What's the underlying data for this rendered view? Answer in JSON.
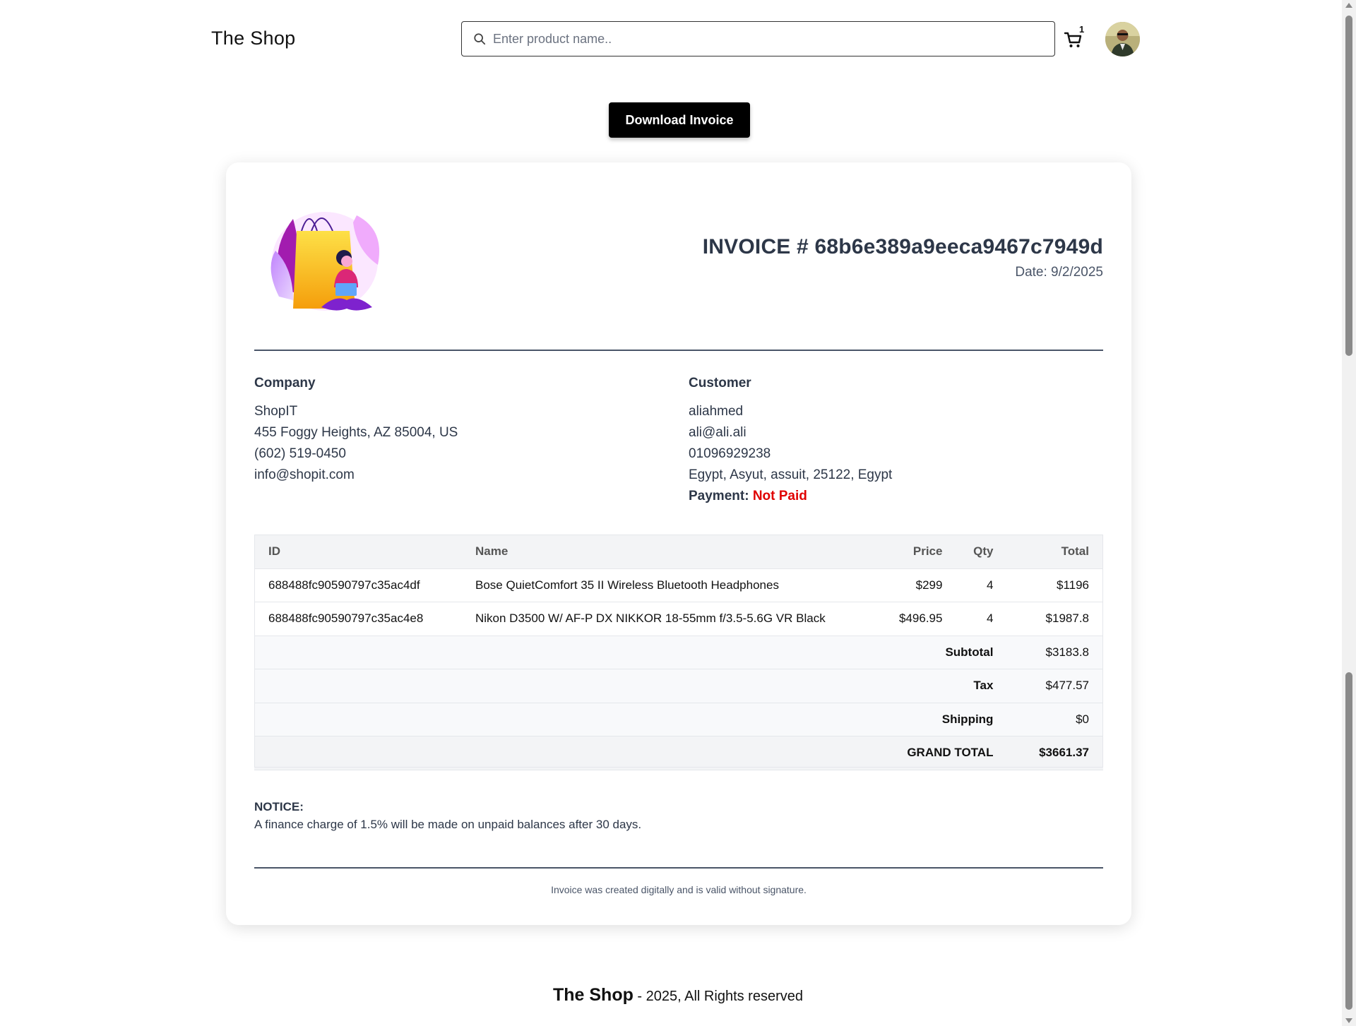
{
  "header": {
    "brand": "The Shop",
    "search_placeholder": "Enter product name..",
    "cart_count": "1",
    "icons": {
      "search": "search-icon",
      "cart": "cart-icon"
    }
  },
  "actions": {
    "download_label": "Download Invoice"
  },
  "invoice": {
    "title": "INVOICE # 68b6e389a9eeca9467c7949d",
    "date": "Date: 9/2/2025",
    "company": {
      "heading": "Company",
      "lines": [
        "ShopIT",
        "455 Foggy Heights, AZ 85004, US",
        "(602) 519-0450",
        "info@shopit.com"
      ]
    },
    "customer": {
      "heading": "Customer",
      "lines": [
        "aliahmed",
        "ali@ali.ali",
        "01096929238",
        "Egypt, Asyut, assuit, 25122, Egypt"
      ],
      "payment_label": "Payment:",
      "payment_status": "Not Paid"
    },
    "table": {
      "headers": [
        "ID",
        "Name",
        "Price",
        "Qty",
        "Total"
      ],
      "rows": [
        [
          "688488fc90590797c35ac4df",
          "Bose QuietComfort 35 II Wireless Bluetooth Headphones",
          "$299",
          "4",
          "$1196"
        ],
        [
          "688488fc90590797c35ac4e8",
          "Nikon D3500 W/ AF-P DX NIKKOR 18-55mm f/3.5-5.6G VR Black",
          "$496.95",
          "4",
          "$1987.8"
        ]
      ],
      "subtotal_label": "Subtotal",
      "subtotal": "$3183.8",
      "tax_label": "Tax",
      "tax": "$477.57",
      "shipping_label": "Shipping",
      "shipping": "$0",
      "grand_label": "GRAND TOTAL",
      "grand": "$3661.37"
    },
    "notice_heading": "NOTICE:",
    "notice_text": "A finance charge of 1.5% will be made on unpaid balances after 30 days.",
    "footer_note": "Invoice was created digitally and is valid without signature."
  },
  "footer": {
    "brand": "The Shop",
    "text": " - 2025, All Rights reserved"
  },
  "colors": {
    "accent": "#000000",
    "unpaid": "#e00000",
    "text": "#2d3748"
  }
}
